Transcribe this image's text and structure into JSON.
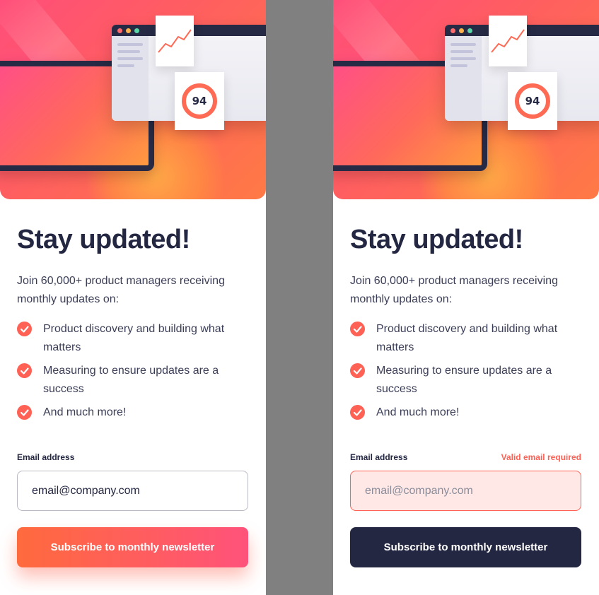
{
  "colors": {
    "accent": "#ff6155",
    "dark_navy": "#242742",
    "gray_separator": "#808080",
    "error_bg": "#ffe8e6"
  },
  "panels": [
    {
      "state": "default",
      "illustration": {
        "score": "94"
      },
      "title": "Stay updated!",
      "intro": "Join 60,000+ product managers receiving monthly updates on:",
      "features": [
        "Product discovery and building what matters",
        "Measuring to ensure updates are a success",
        "And much more!"
      ],
      "email_label": "Email address",
      "email_error": "",
      "email_value": "email@company.com",
      "button_label": "Subscribe to monthly newsletter"
    },
    {
      "state": "error",
      "illustration": {
        "score": "94"
      },
      "title": "Stay updated!",
      "intro": "Join 60,000+ product managers receiving monthly updates on:",
      "features": [
        "Product discovery and building what matters",
        "Measuring to ensure updates are a success",
        "And much more!"
      ],
      "email_label": "Email address",
      "email_error": "Valid email required",
      "email_value": "email@company.com",
      "button_label": "Subscribe to monthly newsletter"
    }
  ]
}
